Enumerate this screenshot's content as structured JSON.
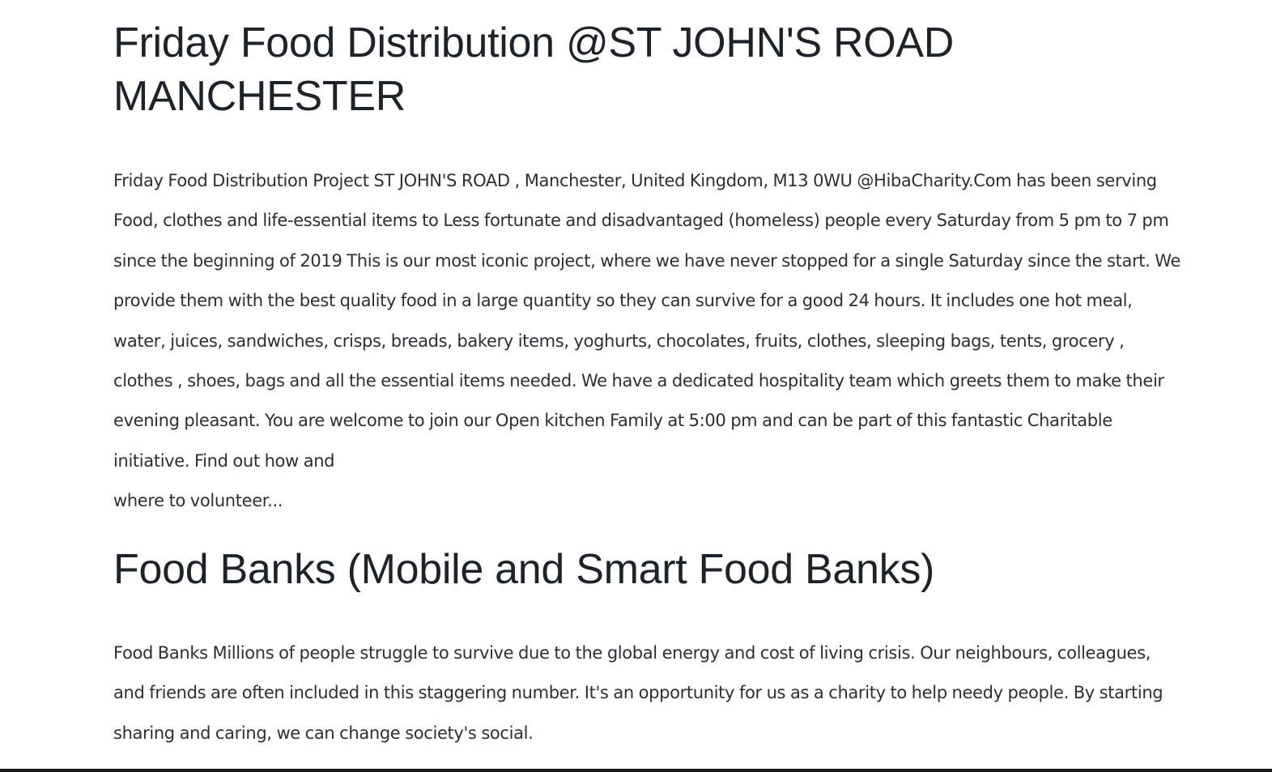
{
  "sections": [
    {
      "heading": "Friday Food Distribution @ST JOHN'S ROAD MANCHESTER",
      "body": "Friday Food Distribution Project ST JOHN'S ROAD , Manchester, United Kingdom, M13 0WU @HibaCharity.Com has been serving Food, clothes and life-essential items to Less fortunate and disadvantaged (homeless) people every Saturday from 5 pm to 7 pm since the beginning of 2019 This is our most iconic project, where we have never stopped for a single Saturday since the start. We provide them with the best quality food in a large quantity so they can survive for a good 24 hours. It includes one hot meal, water, juices, sandwiches, crisps, breads, bakery items, yoghurts, chocolates, fruits, clothes, sleeping bags, tents, grocery , clothes , shoes, bags and all the essential items needed. We have a dedicated hospitality team which greets them to make their evening pleasant. You are welcome to join our Open kitchen Family at 5:00 pm and can be part of this fantastic Charitable initiative. Find out how and",
      "body_tail": "where to volunteer..."
    },
    {
      "heading": "Food Banks (Mobile and Smart Food Banks)",
      "body": "Food Banks Millions of people struggle to survive due to the global energy and cost of living crisis. Our neighbours, colleagues, and friends are often included in this staggering number. It's an opportunity for us as a charity to help needy people. By starting sharing and caring, we can change society's social."
    }
  ]
}
